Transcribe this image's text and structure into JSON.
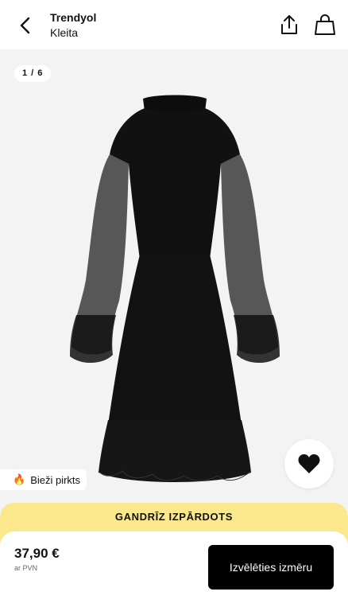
{
  "header": {
    "brand": "Trendyol",
    "subtitle": "Kleita",
    "icons": {
      "back": "chevron-left-icon",
      "share": "share-icon",
      "bag": "shopping-bag-icon"
    }
  },
  "gallery": {
    "counter": "1 / 6",
    "badge_emoji": "🔥",
    "badge_label": "Bieži pirkts",
    "favorite_icon": "heart-icon"
  },
  "banner": {
    "text": "GANDRĪZ IZPĀRDOTS",
    "color": "#fbe78c"
  },
  "footer": {
    "price": "37,90 €",
    "vat_note": "ar PVN",
    "size_button_label": "Izvēlēties izmēru"
  }
}
